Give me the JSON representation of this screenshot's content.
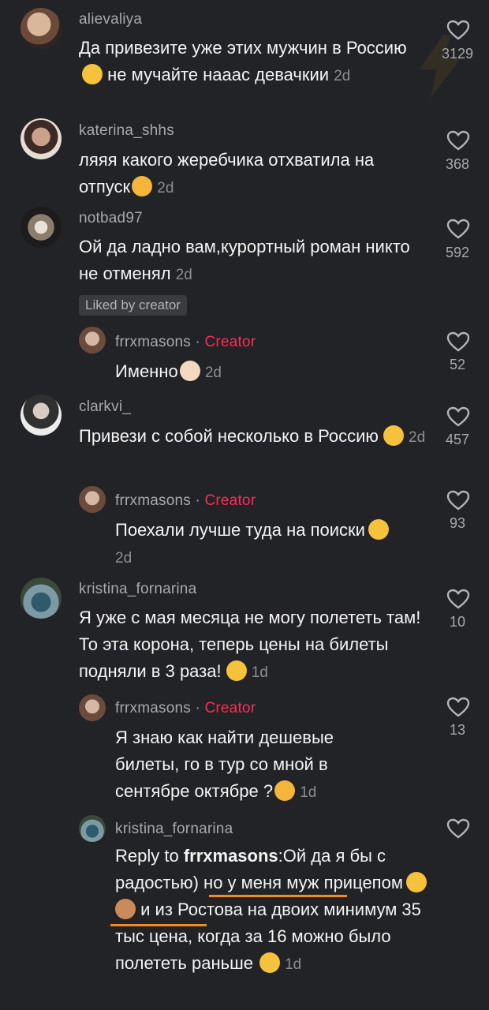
{
  "comments": [
    {
      "user": "alievaliya",
      "text": "Да привезите уже этих мужчин в Россию",
      "text2": "не мучайте нааас девачкии",
      "time": "2d",
      "likes": "3129"
    },
    {
      "user": "katerina_shhs",
      "text": "ляяя какого жеребчика отхватила на отпуск",
      "time": "2d",
      "likes": "368"
    },
    {
      "user": "notbad97",
      "text": "Ой да ладно вам,курортный роман никто не отменял",
      "time": "2d",
      "likes": "592",
      "badge": "Liked by creator"
    },
    {
      "user": "frrxmasons",
      "creator": "Creator",
      "text": "Именно",
      "time": "2d",
      "likes": "52"
    },
    {
      "user": "clarkvi_",
      "text": "Привези с собой несколько в Россию",
      "time": "2d",
      "likes": "457"
    },
    {
      "user": "frrxmasons",
      "creator": "Creator",
      "text": "Поехали лучше туда на поиски",
      "time": "2d",
      "likes": "93"
    },
    {
      "user": "kristina_fornarina",
      "text": "Я уже с мая месяца не могу полететь там!То эта корона, теперь цены на билеты подняли в 3 раза!",
      "time": "1d",
      "likes": "10"
    },
    {
      "user": "frrxmasons",
      "creator": "Creator",
      "text": "Я знаю как найти дешевые билеты, го в тур со мной в сентябре октябре ?",
      "time": "1d",
      "likes": "13"
    },
    {
      "user": "kristina_fornarina",
      "reply_prefix": "Reply to ",
      "reply_to": "frrxmasons",
      "text": ":Ой да я бы с радостью)",
      "text_u1": "но у меня муж",
      "text_u2": "прицепом",
      "text_rest": "и из Ростова на двоих минимум 35 тыс цена, когда за 16 можно было полететь раньше",
      "time": "1d"
    }
  ],
  "separator": " · ",
  "colors": {
    "background": "#222326",
    "accent": "#fe2c55",
    "underline": "#f28b21"
  }
}
